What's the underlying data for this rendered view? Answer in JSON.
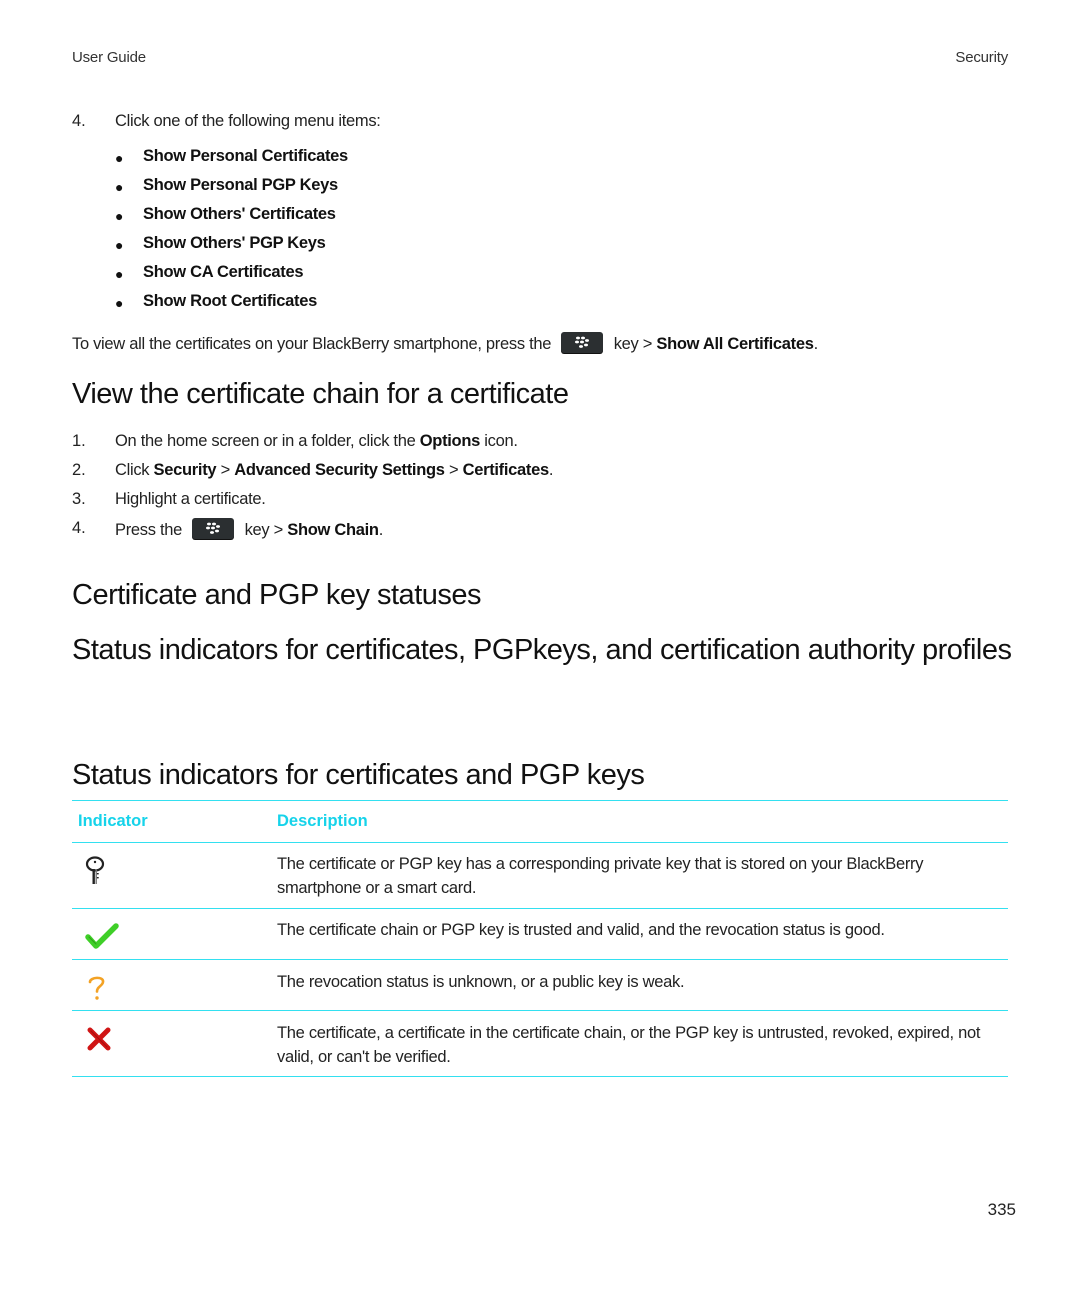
{
  "header": {
    "left": "User Guide",
    "right": "Security"
  },
  "intro_step": {
    "number": "4.",
    "text": "Click one of the following menu items:",
    "menu_items": [
      "Show Personal Certificates",
      "Show Personal PGP Keys",
      "Show Others' Certificates",
      "Show Others' PGP Keys",
      "Show CA Certificates",
      "Show Root Certificates"
    ]
  },
  "view_all_note": {
    "before": "To view all the certificates on your BlackBerry smartphone, press the",
    "key_icon": "blackberry-menu-key-icon",
    "after": "key >",
    "bold": "Show All Certificates",
    "end": "."
  },
  "section_chain": {
    "title": "View the certificate chain for a certificate",
    "steps": [
      {
        "num": "1.",
        "pre": "On the home screen or in a folder, click the",
        "bold": "Options",
        "post": "icon."
      },
      {
        "num": "2.",
        "pre": "Click",
        "bold1": "Security",
        "sep1": ">",
        "bold2": "Advanced Security Settings",
        "sep2": ">",
        "bold3": "Certificates",
        "end": "."
      },
      {
        "num": "3.",
        "text": "Highlight a certificate."
      },
      {
        "num": "4.",
        "pre": "Press the",
        "key_icon": "blackberry-menu-key-icon",
        "mid": "key >",
        "bold": "Show Chain",
        "end": "."
      }
    ]
  },
  "heading_statuses": "Certificate and PGP key statuses",
  "heading_status_indicators": "Status indicators for certificates, PGPkeys, and certification authority profiles",
  "heading_table": "Status indicators for certificates and PGP keys",
  "table": {
    "columns": [
      "Indicator",
      "Description"
    ],
    "accent_color": "#16d3ea",
    "rows": [
      {
        "icon": "key-icon",
        "description": "The certificate or PGP key has a corresponding private key that is stored on your BlackBerry smartphone or a smart card."
      },
      {
        "icon": "green-checkmark-icon",
        "description": "The certificate chain or PGP key is trusted and valid, and the revocation status is good."
      },
      {
        "icon": "orange-question-mark-icon",
        "description": "The revocation status is unknown, or a public key is weak."
      },
      {
        "icon": "red-x-icon",
        "description": "The certificate, a certificate in the certificate chain, or the PGP key is untrusted, revoked, expired, not valid, or can't be verified."
      }
    ]
  },
  "page_number": "335"
}
